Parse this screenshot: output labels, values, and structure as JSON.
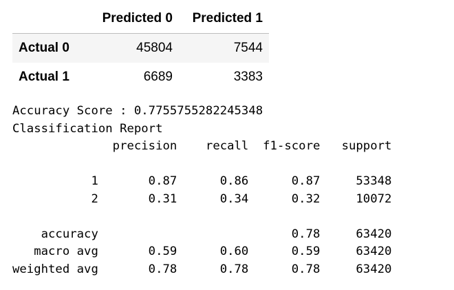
{
  "matrix": {
    "columns": [
      "Predicted 0",
      "Predicted 1"
    ],
    "rows": [
      {
        "label": "Actual 0",
        "values": [
          "45804",
          "7544"
        ]
      },
      {
        "label": "Actual 1",
        "values": [
          "6689",
          "3383"
        ]
      }
    ]
  },
  "report": {
    "accuracy_line": "Accuracy Score : 0.7755755282245348",
    "title": "Classification Report",
    "header": "              precision    recall  f1-score   support",
    "blank1": " ",
    "row_1": "           1       0.87      0.86      0.87     53348",
    "row_2": "           2       0.31      0.34      0.32     10072",
    "blank2": " ",
    "accuracy": "    accuracy                           0.78     63420",
    "macro_avg": "   macro avg       0.59      0.60      0.59     63420",
    "weighted_avg": "weighted avg       0.78      0.78      0.78     63420"
  }
}
